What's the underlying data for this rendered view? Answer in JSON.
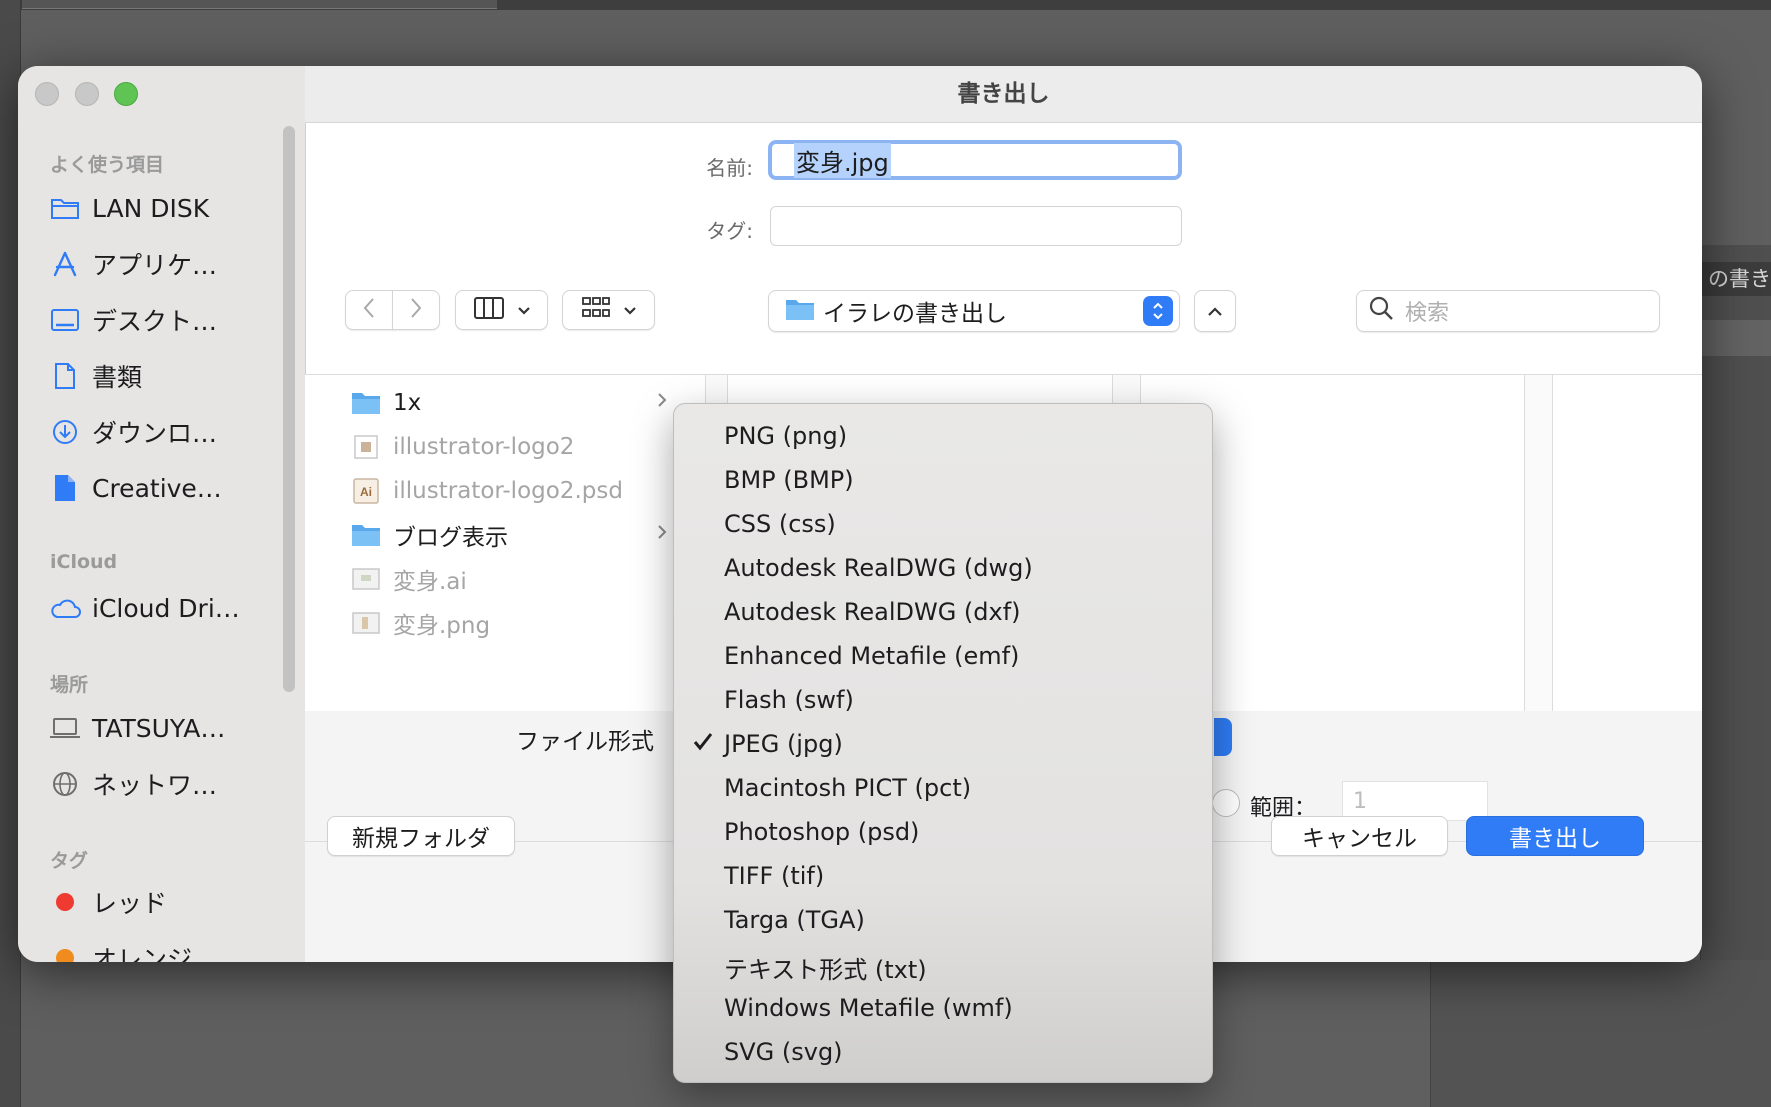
{
  "dialog": {
    "title": "書き出し",
    "name_label": "名前:",
    "name_value": "変身.jpg",
    "tags_label": "タグ:",
    "location": "イラレの書き出し",
    "search_placeholder": "検索"
  },
  "sidebar": {
    "favorites_title": "よく使う項目",
    "favorites": [
      {
        "label": "LAN DISK",
        "icon": "folder-icon"
      },
      {
        "label": "アプリケ…",
        "icon": "applications-icon"
      },
      {
        "label": "デスクト…",
        "icon": "desktop-icon"
      },
      {
        "label": "書類",
        "icon": "document-icon"
      },
      {
        "label": "ダウンロ…",
        "icon": "download-icon"
      },
      {
        "label": "Creative…",
        "icon": "file-icon"
      }
    ],
    "icloud_title": "iCloud",
    "icloud": [
      {
        "label": "iCloud Dri…",
        "icon": "cloud-icon"
      }
    ],
    "places_title": "場所",
    "places": [
      {
        "label": "TATSUYA…",
        "icon": "laptop-icon"
      },
      {
        "label": "ネットワ…",
        "icon": "globe-icon"
      }
    ],
    "tags_title": "タグ",
    "tags": [
      {
        "label": "レッド",
        "color": "#ee3a31"
      },
      {
        "label": "オレンジ",
        "color": "#f08b1d"
      }
    ]
  },
  "files": [
    {
      "name": "1x",
      "type": "folder",
      "dim": false,
      "chevron": true
    },
    {
      "name": "illustrator-logo2",
      "type": "ai-file",
      "dim": true,
      "chevron": false
    },
    {
      "name": "illustrator-logo2.psd",
      "type": "psd-file",
      "dim": true,
      "chevron": false
    },
    {
      "name": "ブログ表示",
      "type": "folder",
      "dim": false,
      "chevron": true
    },
    {
      "name": "変身.ai",
      "type": "image-file",
      "dim": true,
      "chevron": false
    },
    {
      "name": "変身.png",
      "type": "image-file",
      "dim": true,
      "chevron": false
    }
  ],
  "options": {
    "format_label": "ファイル形式",
    "range_label": "範囲：",
    "range_value": "1"
  },
  "buttons": {
    "new_folder": "新規フォルダ",
    "cancel": "キャンセル",
    "export": "書き出し"
  },
  "background": {
    "right_panel_text": "の書き出"
  },
  "format_menu": {
    "selected": "JPEG (jpg)",
    "items": [
      "PNG (png)",
      "BMP (BMP)",
      "CSS (css)",
      "Autodesk RealDWG (dwg)",
      "Autodesk RealDWG (dxf)",
      "Enhanced Metafile (emf)",
      "Flash (swf)",
      "JPEG (jpg)",
      "Macintosh PICT (pct)",
      "Photoshop (psd)",
      "TIFF (tif)",
      "Targa (TGA)",
      "テキスト形式 (txt)",
      "Windows Metafile (wmf)",
      "SVG (svg)"
    ]
  },
  "colors": {
    "accent": "#2f7cf6",
    "selection": "#b4d2fb",
    "focus_ring": "#8cb4f3"
  }
}
